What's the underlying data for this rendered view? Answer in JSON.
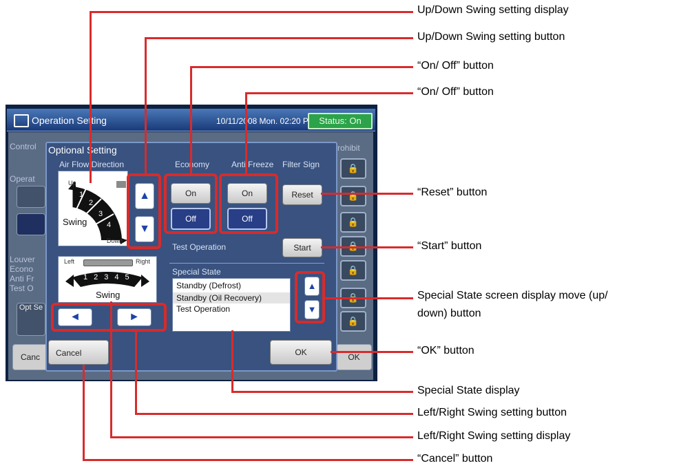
{
  "screen": {
    "title": "Operation Setting",
    "datetime": "10/11/2008 Mon. 02:20 PM",
    "status": "Status: On",
    "background_labels": {
      "control": "Control",
      "operation": "Operat",
      "prohibit": "rohibit",
      "louver": "Louver",
      "econo": "Econo",
      "anti": "Anti Fr",
      "test": "Test O",
      "option_btn": "Opt Se",
      "cancel_btn": "Canc",
      "ok_btn": "OK"
    },
    "lock_glyph": "🔒"
  },
  "dialog": {
    "title": "Optional Setting",
    "headers": {
      "air_flow": "Air Flow Direction",
      "economy": "Economy",
      "anti_freeze": "Anti Freeze",
      "filter_sign": "Filter Sign"
    },
    "air_flow": {
      "up_label": "Up",
      "down_label": "Down",
      "swing_label": "Swing",
      "segments": [
        "1",
        "2",
        "3",
        "4"
      ],
      "lr_left": "Left",
      "lr_right": "Right",
      "lr_segments": [
        "1",
        "2",
        "3",
        "4",
        "5"
      ],
      "lr_swing": "Swing",
      "up_arrow": "▲",
      "down_arrow": "▼",
      "left_arrow": "◄",
      "right_arrow": "►"
    },
    "economy": {
      "on": "On",
      "off": "Off"
    },
    "anti_freeze": {
      "on": "On",
      "off": "Off"
    },
    "filter_reset": "Reset",
    "test_operation": {
      "label": "Test Operation",
      "start": "Start"
    },
    "special_state": {
      "label": "Special State",
      "items": [
        "Standby (Defrost)",
        "Standby (Oil Recovery)",
        "Test Operation"
      ],
      "up_arrow": "▲",
      "down_arrow": "▼"
    },
    "cancel": "Cancel",
    "ok": "OK"
  },
  "annotations": {
    "ud_display": "Up/Down Swing setting display",
    "ud_button": "Up/Down Swing setting button",
    "onoff_1": "“On/ Off” button",
    "onoff_2": "“On/ Off” button",
    "reset": "“Reset” button",
    "start": "“Start” button",
    "special_move_1": "Special State screen display move (up/",
    "special_move_2": "down) button",
    "ok": "“OK” button",
    "special_display": "Special State display",
    "lr_button": "Left/Right Swing setting button",
    "lr_display": "Left/Right Swing setting display",
    "cancel": "“Cancel” button"
  }
}
